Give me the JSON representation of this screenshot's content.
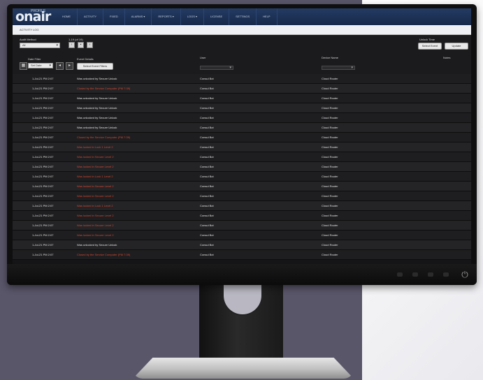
{
  "colors": {
    "header_bg": "#1f355c",
    "table_bg": "#1e1e20",
    "text": "#e4e4e4",
    "alert": "#d9472f",
    "backdrop": "#5a566a"
  },
  "app": {
    "logo_text": "onair",
    "logo_small": "PROFILE",
    "nav": [
      "HOME",
      "ACTIVITY",
      "FIXED",
      "ALARMS ▾",
      "REPORTS ▾",
      "LOGS ▾",
      "LICENSE",
      "SETTINGS",
      "HELP"
    ],
    "subheader": "ACTIVITY LOG"
  },
  "controls": {
    "audit_method_label": "Audit Method",
    "audit_method_value": "All",
    "range_label": "1-19 (of 19)",
    "page_icons": [
      "chevron-left-icon",
      "page-icon",
      "chevron-right-icon"
    ],
    "unlock_label": "Unlock Time",
    "unlock_value_btn": "Select Event",
    "update_btn": "Update",
    "date_filter_label": "Date Filter",
    "date_filter_value": "Set Date",
    "event_filter_label": "Event Details",
    "event_filter_btn": "Select Event Filters",
    "user_col_label": "User",
    "device_col_label": "Device Name",
    "notes_col_label": "Notes"
  },
  "rows": [
    {
      "time": "1-Jul-21 PM 2:07",
      "msg": "Was unlocked by Secure Unlock",
      "user": "Consul Bot",
      "device": "Cloud Router",
      "alert": false
    },
    {
      "time": "1-Jul-21 PM 2:07",
      "msg": "Closed by the Service Computer (PM 7:39)",
      "user": "Consul Bot",
      "device": "Cloud Router",
      "alert": true
    },
    {
      "time": "1-Jul-21 PM 2:07",
      "msg": "Was unlocked by Secure Unlock",
      "user": "Consul Bot",
      "device": "Cloud Router",
      "alert": false
    },
    {
      "time": "1-Jul-21 PM 2:07",
      "msg": "Was unlocked by Secure Unlock",
      "user": "Consul Bot",
      "device": "Cloud Router",
      "alert": false
    },
    {
      "time": "1-Jul-21 PM 2:07",
      "msg": "Was unlocked by Secure Unlock",
      "user": "Consul Bot",
      "device": "Cloud Router",
      "alert": false
    },
    {
      "time": "1-Jul-21 PM 2:07",
      "msg": "Was unlocked by Secure Unlock",
      "user": "Consul Bot",
      "device": "Cloud Router",
      "alert": false
    },
    {
      "time": "1-Jul-21 PM 2:07",
      "msg": "Closed by the Service Computer (PM 7:39)",
      "user": "Consul Bot",
      "device": "Cloud Router",
      "alert": true
    },
    {
      "time": "1-Jul-21 PM 2:07",
      "msg": "Was locked in Lock 1 Level 2",
      "user": "Consul Bot",
      "device": "Cloud Router",
      "alert": true
    },
    {
      "time": "1-Jul-21 PM 2:07",
      "msg": "Was locked in Secure Level 2",
      "user": "Consul Bot",
      "device": "Cloud Router",
      "alert": true
    },
    {
      "time": "1-Jul-21 PM 2:07",
      "msg": "Was locked in Secure Level 2",
      "user": "Consul Bot",
      "device": "Cloud Router",
      "alert": true
    },
    {
      "time": "1-Jul-21 PM 2:07",
      "msg": "Was locked in Lock 1 Level 2",
      "user": "Consul Bot",
      "device": "Cloud Router",
      "alert": true
    },
    {
      "time": "1-Jul-21 PM 2:07",
      "msg": "Was locked in Secure Level 2",
      "user": "Consul Bot",
      "device": "Cloud Router",
      "alert": true
    },
    {
      "time": "1-Jul-21 PM 2:07",
      "msg": "Was locked in Secure Level 2",
      "user": "Consul Bot",
      "device": "Cloud Router",
      "alert": true
    },
    {
      "time": "1-Jul-21 PM 2:07",
      "msg": "Was locked in Lock 1 Level 2",
      "user": "Consul Bot",
      "device": "Cloud Router",
      "alert": true
    },
    {
      "time": "1-Jul-21 PM 2:07",
      "msg": "Was locked in Secure Level 2",
      "user": "Consul Bot",
      "device": "Cloud Router",
      "alert": true
    },
    {
      "time": "1-Jul-21 PM 2:07",
      "msg": "Was locked in Secure Level 2",
      "user": "Consul Bot",
      "device": "Cloud Router",
      "alert": true
    },
    {
      "time": "1-Jul-21 PM 2:07",
      "msg": "Was locked in Secure Level 2",
      "user": "Consul Bot",
      "device": "Cloud Router",
      "alert": true
    },
    {
      "time": "1-Jul-21 PM 2:07",
      "msg": "Was unlocked by Secure Unlock",
      "user": "Consul Bot",
      "device": "Cloud Router",
      "alert": false
    },
    {
      "time": "1-Jul-21 PM 2:07",
      "msg": "Closed by the Service Computer (PM 7:39)",
      "user": "Consul Bot",
      "device": "Cloud Router",
      "alert": true
    }
  ]
}
